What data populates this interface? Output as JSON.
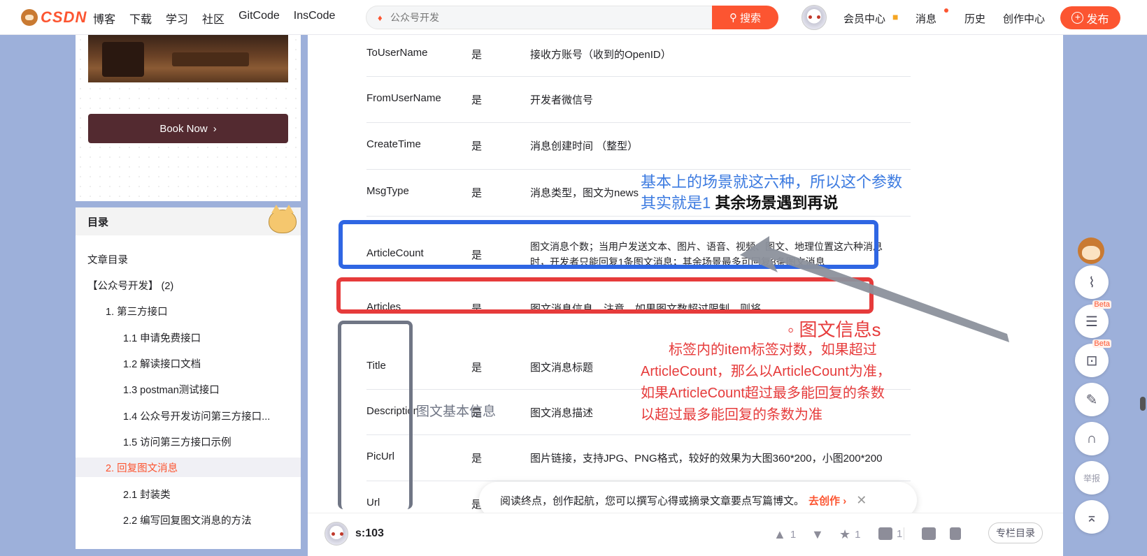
{
  "topnav": {
    "logo": "CSDN",
    "links": [
      "博客",
      "下载",
      "学习",
      "社区",
      "GitCode",
      "InsCode"
    ],
    "search_placeholder": "公众号开发",
    "search_button": "搜索",
    "member": "会员中心",
    "messages": "消息",
    "history": "历史",
    "creator": "创作中心",
    "publish": "发布"
  },
  "sidebar": {
    "book_now": "Book Now",
    "toc_title": "目录",
    "toc_items": [
      "文章目录",
      "【公众号开发】 (2)",
      "1. 第三方接口",
      "1.1 申请免费接口",
      "1.2 解读接口文档",
      "1.3 postman测试接口",
      "1.4 公众号开发访问第三方接口...",
      "1.5 访问第三方接口示例",
      "2. 回复图文消息",
      "2.1 封装类",
      "2.2 编写回复图文消息的方法"
    ],
    "active_index": 8
  },
  "table": {
    "rows": [
      {
        "name": "ToUserName",
        "required": "是",
        "desc": "接收方账号（收到的OpenID）"
      },
      {
        "name": "FromUserName",
        "required": "是",
        "desc": "开发者微信号"
      },
      {
        "name": "CreateTime",
        "required": "是",
        "desc": "消息创建时间 （整型）"
      },
      {
        "name": "MsgType",
        "required": "是",
        "desc": "消息类型，图文为news"
      },
      {
        "name": "ArticleCount",
        "required": "是",
        "desc": "图文消息个数；当用户发送文本、图片、语音、视频、图文、地理位置这六种消息时，开发者只能回复1条图文消息；其余场景最多可回复8条图文消息"
      },
      {
        "name": "Articles",
        "required": "是",
        "desc": "图文消息信息，注意，如果图文数超过限制，则将只发限制内的条数"
      },
      {
        "name": "Title",
        "required": "是",
        "desc": "图文消息标题"
      },
      {
        "name": "Description",
        "required": "是",
        "desc": "图文消息描述"
      },
      {
        "name": "PicUrl",
        "required": "是",
        "desc": "图片链接，支持JPG、PNG格式，较好的效果为大图360*200，小图200*200"
      },
      {
        "name": "Url",
        "required": "是",
        "desc": ""
      }
    ]
  },
  "annotations": {
    "blue_line1": "基本上的场景就这六种，所以这个参数",
    "blue_line2": "其实就是1",
    "blue_bold": " 其余场景遇到再说",
    "red_title": "◦ 图文信息s",
    "red_lines": [
      "标签内的item标签对数，如果超过",
      "ArticleCount，那么以ArticleCount为准，",
      "如果ArticleCount超过最多能回复的条数",
      "以超过最多能回复的条数为准"
    ],
    "gray_label": "图文基本信息"
  },
  "toast": {
    "text": "阅读终点，创作起航，您可以撰写心得或摘录文章要点写篇博文。",
    "action": "去创作",
    "chevron": "›",
    "close": "✕"
  },
  "bottombar": {
    "author": "s:103",
    "likes": "1",
    "favorites": "1",
    "comments": "1",
    "column_dir": "专栏目录"
  },
  "rightbar": {
    "beta": "Beta",
    "report": "举报"
  }
}
